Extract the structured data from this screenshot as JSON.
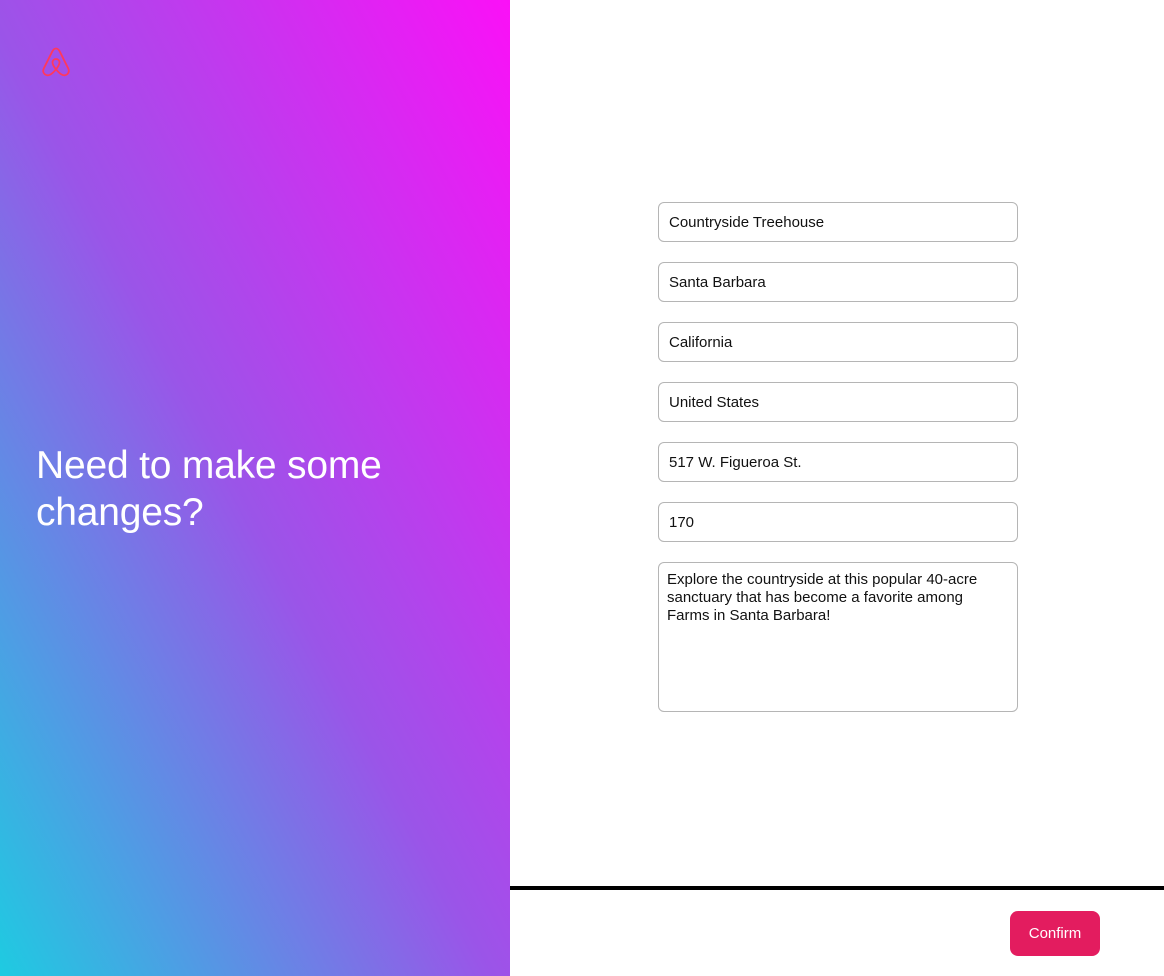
{
  "colors": {
    "gradient_start": "#1ecbe1",
    "gradient_mid": "#9a55e8",
    "gradient_end": "#fb10f7",
    "brand_accent": "#e31c5f",
    "logo_color": "#ff385c"
  },
  "logo": {
    "icon": "airbnb-logo-icon"
  },
  "hero": {
    "headline": "Need to make some changes?"
  },
  "form": {
    "title_value": "Countryside Treehouse",
    "city_value": "Santa Barbara",
    "state_value": "California",
    "country_value": "United States",
    "address_value": "517 W. Figueroa St.",
    "price_value": "170",
    "description_value": "Explore the countryside at this popular 40-acre sanctuary that has become a favorite among Farms in Santa Barbara!"
  },
  "footer": {
    "confirm_label": "Confirm"
  }
}
